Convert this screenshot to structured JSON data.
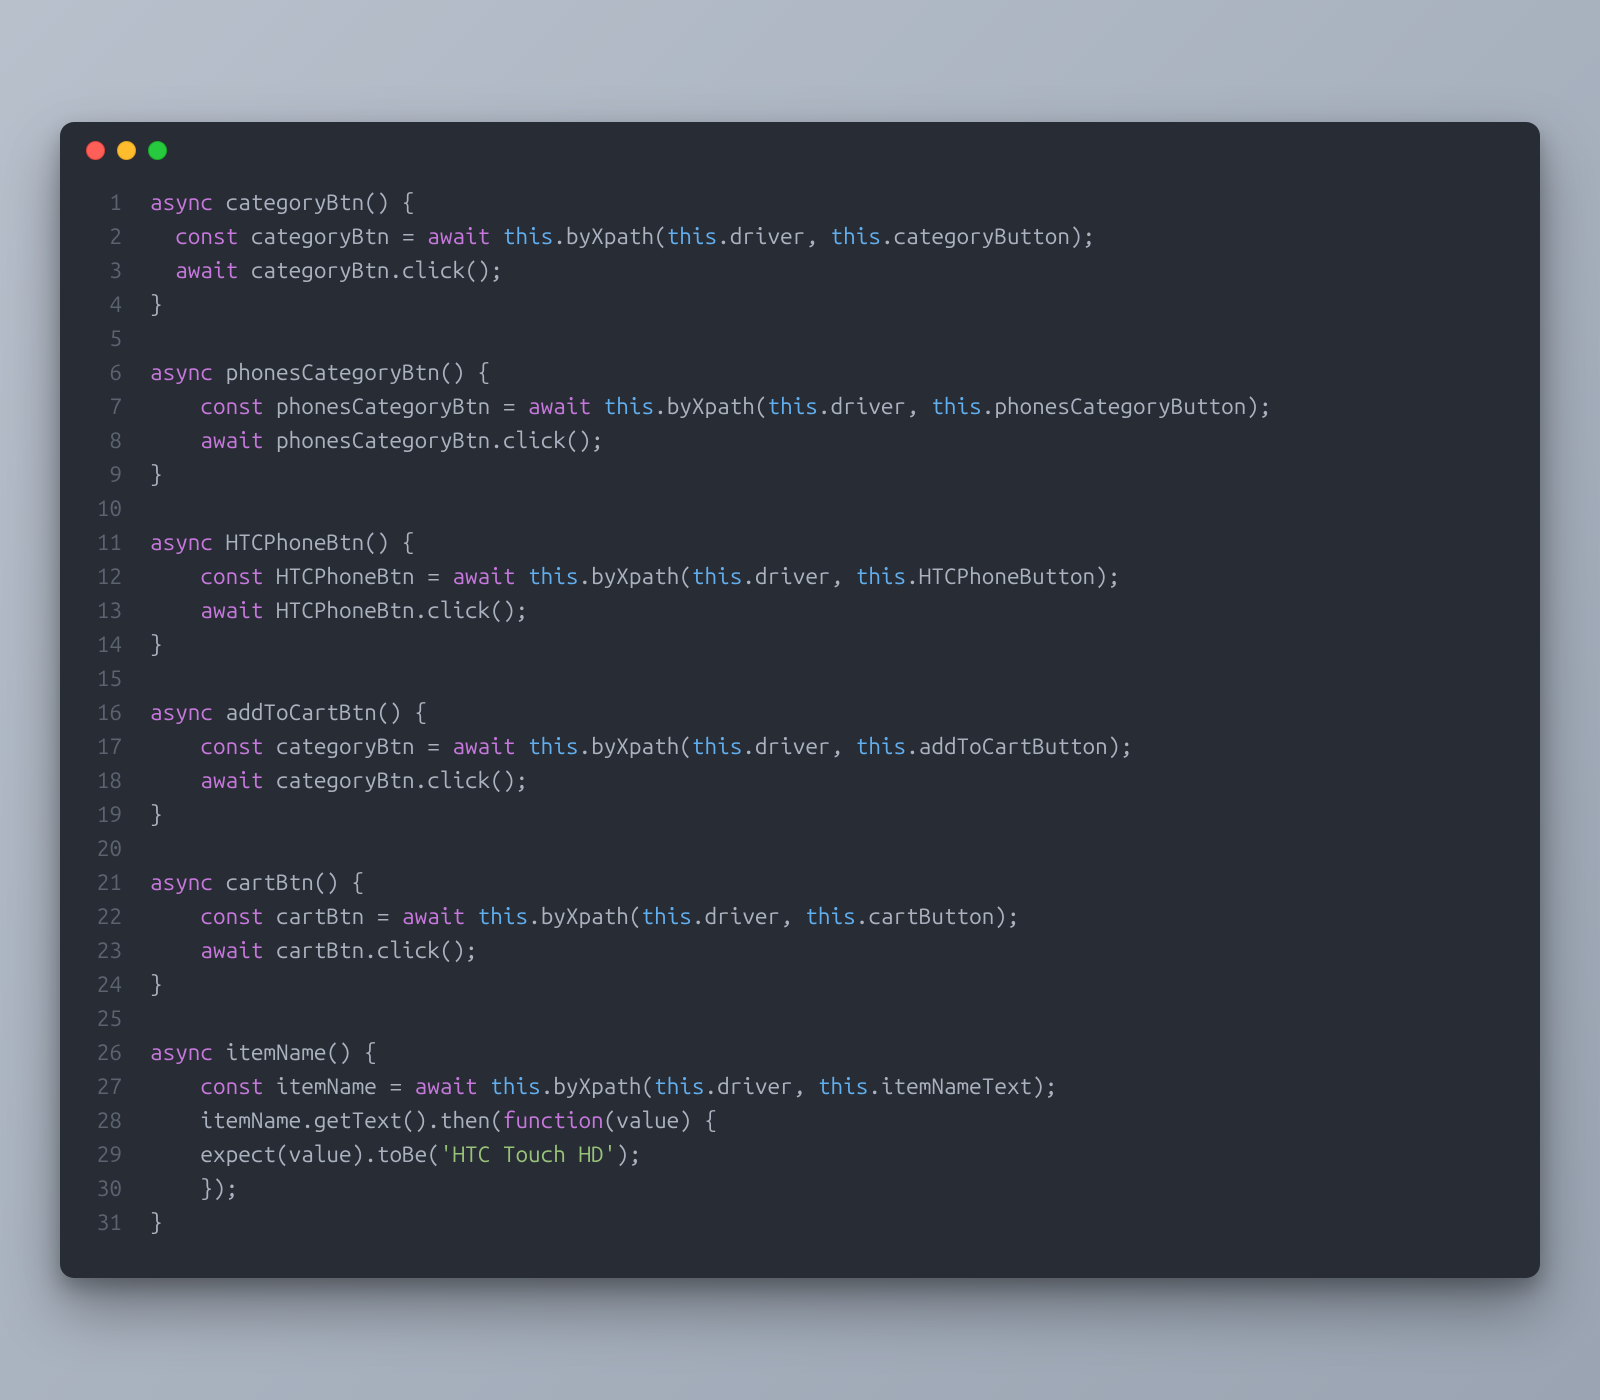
{
  "window": {
    "traffic_lights": [
      "close",
      "minimize",
      "zoom"
    ]
  },
  "code": {
    "lines": [
      {
        "n": 1,
        "tokens": [
          [
            "kw",
            "async"
          ],
          [
            "punc",
            " "
          ],
          [
            "name",
            "categoryBtn"
          ],
          [
            "punc",
            "() {"
          ]
        ]
      },
      {
        "n": 2,
        "tokens": [
          [
            "punc",
            "  "
          ],
          [
            "kw",
            "const"
          ],
          [
            "punc",
            " "
          ],
          [
            "name",
            "categoryBtn"
          ],
          [
            "punc",
            " = "
          ],
          [
            "kw",
            "await"
          ],
          [
            "punc",
            " "
          ],
          [
            "this",
            "this"
          ],
          [
            "punc",
            "."
          ],
          [
            "name",
            "byXpath"
          ],
          [
            "punc",
            "("
          ],
          [
            "this",
            "this"
          ],
          [
            "punc",
            "."
          ],
          [
            "name",
            "driver"
          ],
          [
            "punc",
            ", "
          ],
          [
            "this",
            "this"
          ],
          [
            "punc",
            "."
          ],
          [
            "name",
            "categoryButton"
          ],
          [
            "punc",
            ");"
          ]
        ]
      },
      {
        "n": 3,
        "tokens": [
          [
            "punc",
            "  "
          ],
          [
            "kw",
            "await"
          ],
          [
            "punc",
            " "
          ],
          [
            "name",
            "categoryBtn"
          ],
          [
            "punc",
            "."
          ],
          [
            "name",
            "click"
          ],
          [
            "punc",
            "();"
          ]
        ]
      },
      {
        "n": 4,
        "tokens": [
          [
            "punc",
            "}"
          ]
        ]
      },
      {
        "n": 5,
        "tokens": [
          [
            "punc",
            ""
          ]
        ]
      },
      {
        "n": 6,
        "tokens": [
          [
            "kw",
            "async"
          ],
          [
            "punc",
            " "
          ],
          [
            "name",
            "phonesCategoryBtn"
          ],
          [
            "punc",
            "() {"
          ]
        ]
      },
      {
        "n": 7,
        "tokens": [
          [
            "punc",
            "    "
          ],
          [
            "kw",
            "const"
          ],
          [
            "punc",
            " "
          ],
          [
            "name",
            "phonesCategoryBtn"
          ],
          [
            "punc",
            " = "
          ],
          [
            "kw",
            "await"
          ],
          [
            "punc",
            " "
          ],
          [
            "this",
            "this"
          ],
          [
            "punc",
            "."
          ],
          [
            "name",
            "byXpath"
          ],
          [
            "punc",
            "("
          ],
          [
            "this",
            "this"
          ],
          [
            "punc",
            "."
          ],
          [
            "name",
            "driver"
          ],
          [
            "punc",
            ", "
          ],
          [
            "this",
            "this"
          ],
          [
            "punc",
            "."
          ],
          [
            "name",
            "phonesCategoryButton"
          ],
          [
            "punc",
            ");"
          ]
        ]
      },
      {
        "n": 8,
        "tokens": [
          [
            "punc",
            "    "
          ],
          [
            "kw",
            "await"
          ],
          [
            "punc",
            " "
          ],
          [
            "name",
            "phonesCategoryBtn"
          ],
          [
            "punc",
            "."
          ],
          [
            "name",
            "click"
          ],
          [
            "punc",
            "();"
          ]
        ]
      },
      {
        "n": 9,
        "tokens": [
          [
            "punc",
            "}"
          ]
        ]
      },
      {
        "n": 10,
        "tokens": [
          [
            "punc",
            ""
          ]
        ]
      },
      {
        "n": 11,
        "tokens": [
          [
            "kw",
            "async"
          ],
          [
            "punc",
            " "
          ],
          [
            "name",
            "HTCPhoneBtn"
          ],
          [
            "punc",
            "() {"
          ]
        ]
      },
      {
        "n": 12,
        "tokens": [
          [
            "punc",
            "    "
          ],
          [
            "kw",
            "const"
          ],
          [
            "punc",
            " "
          ],
          [
            "name",
            "HTCPhoneBtn"
          ],
          [
            "punc",
            " = "
          ],
          [
            "kw",
            "await"
          ],
          [
            "punc",
            " "
          ],
          [
            "this",
            "this"
          ],
          [
            "punc",
            "."
          ],
          [
            "name",
            "byXpath"
          ],
          [
            "punc",
            "("
          ],
          [
            "this",
            "this"
          ],
          [
            "punc",
            "."
          ],
          [
            "name",
            "driver"
          ],
          [
            "punc",
            ", "
          ],
          [
            "this",
            "this"
          ],
          [
            "punc",
            "."
          ],
          [
            "name",
            "HTCPhoneButton"
          ],
          [
            "punc",
            ");"
          ]
        ]
      },
      {
        "n": 13,
        "tokens": [
          [
            "punc",
            "    "
          ],
          [
            "kw",
            "await"
          ],
          [
            "punc",
            " "
          ],
          [
            "name",
            "HTCPhoneBtn"
          ],
          [
            "punc",
            "."
          ],
          [
            "name",
            "click"
          ],
          [
            "punc",
            "();"
          ]
        ]
      },
      {
        "n": 14,
        "tokens": [
          [
            "punc",
            "}"
          ]
        ]
      },
      {
        "n": 15,
        "tokens": [
          [
            "punc",
            ""
          ]
        ]
      },
      {
        "n": 16,
        "tokens": [
          [
            "kw",
            "async"
          ],
          [
            "punc",
            " "
          ],
          [
            "name",
            "addToCartBtn"
          ],
          [
            "punc",
            "() {"
          ]
        ]
      },
      {
        "n": 17,
        "tokens": [
          [
            "punc",
            "    "
          ],
          [
            "kw",
            "const"
          ],
          [
            "punc",
            " "
          ],
          [
            "name",
            "categoryBtn"
          ],
          [
            "punc",
            " = "
          ],
          [
            "kw",
            "await"
          ],
          [
            "punc",
            " "
          ],
          [
            "this",
            "this"
          ],
          [
            "punc",
            "."
          ],
          [
            "name",
            "byXpath"
          ],
          [
            "punc",
            "("
          ],
          [
            "this",
            "this"
          ],
          [
            "punc",
            "."
          ],
          [
            "name",
            "driver"
          ],
          [
            "punc",
            ", "
          ],
          [
            "this",
            "this"
          ],
          [
            "punc",
            "."
          ],
          [
            "name",
            "addToCartButton"
          ],
          [
            "punc",
            ");"
          ]
        ]
      },
      {
        "n": 18,
        "tokens": [
          [
            "punc",
            "    "
          ],
          [
            "kw",
            "await"
          ],
          [
            "punc",
            " "
          ],
          [
            "name",
            "categoryBtn"
          ],
          [
            "punc",
            "."
          ],
          [
            "name",
            "click"
          ],
          [
            "punc",
            "();"
          ]
        ]
      },
      {
        "n": 19,
        "tokens": [
          [
            "punc",
            "}"
          ]
        ]
      },
      {
        "n": 20,
        "tokens": [
          [
            "punc",
            ""
          ]
        ]
      },
      {
        "n": 21,
        "tokens": [
          [
            "kw",
            "async"
          ],
          [
            "punc",
            " "
          ],
          [
            "name",
            "cartBtn"
          ],
          [
            "punc",
            "() {"
          ]
        ]
      },
      {
        "n": 22,
        "tokens": [
          [
            "punc",
            "    "
          ],
          [
            "kw",
            "const"
          ],
          [
            "punc",
            " "
          ],
          [
            "name",
            "cartBtn"
          ],
          [
            "punc",
            " = "
          ],
          [
            "kw",
            "await"
          ],
          [
            "punc",
            " "
          ],
          [
            "this",
            "this"
          ],
          [
            "punc",
            "."
          ],
          [
            "name",
            "byXpath"
          ],
          [
            "punc",
            "("
          ],
          [
            "this",
            "this"
          ],
          [
            "punc",
            "."
          ],
          [
            "name",
            "driver"
          ],
          [
            "punc",
            ", "
          ],
          [
            "this",
            "this"
          ],
          [
            "punc",
            "."
          ],
          [
            "name",
            "cartButton"
          ],
          [
            "punc",
            ");"
          ]
        ]
      },
      {
        "n": 23,
        "tokens": [
          [
            "punc",
            "    "
          ],
          [
            "kw",
            "await"
          ],
          [
            "punc",
            " "
          ],
          [
            "name",
            "cartBtn"
          ],
          [
            "punc",
            "."
          ],
          [
            "name",
            "click"
          ],
          [
            "punc",
            "();"
          ]
        ]
      },
      {
        "n": 24,
        "tokens": [
          [
            "punc",
            "}"
          ]
        ]
      },
      {
        "n": 25,
        "tokens": [
          [
            "punc",
            ""
          ]
        ]
      },
      {
        "n": 26,
        "tokens": [
          [
            "kw",
            "async"
          ],
          [
            "punc",
            " "
          ],
          [
            "name",
            "itemName"
          ],
          [
            "punc",
            "() {"
          ]
        ]
      },
      {
        "n": 27,
        "tokens": [
          [
            "punc",
            "    "
          ],
          [
            "kw",
            "const"
          ],
          [
            "punc",
            " "
          ],
          [
            "name",
            "itemName"
          ],
          [
            "punc",
            " = "
          ],
          [
            "kw",
            "await"
          ],
          [
            "punc",
            " "
          ],
          [
            "this",
            "this"
          ],
          [
            "punc",
            "."
          ],
          [
            "name",
            "byXpath"
          ],
          [
            "punc",
            "("
          ],
          [
            "this",
            "this"
          ],
          [
            "punc",
            "."
          ],
          [
            "name",
            "driver"
          ],
          [
            "punc",
            ", "
          ],
          [
            "this",
            "this"
          ],
          [
            "punc",
            "."
          ],
          [
            "name",
            "itemNameText"
          ],
          [
            "punc",
            ");"
          ]
        ]
      },
      {
        "n": 28,
        "tokens": [
          [
            "punc",
            "    "
          ],
          [
            "name",
            "itemName"
          ],
          [
            "punc",
            "."
          ],
          [
            "name",
            "getText"
          ],
          [
            "punc",
            "()."
          ],
          [
            "name",
            "then"
          ],
          [
            "punc",
            "("
          ],
          [
            "kw",
            "function"
          ],
          [
            "punc",
            "("
          ],
          [
            "name",
            "value"
          ],
          [
            "punc",
            ") {"
          ]
        ]
      },
      {
        "n": 29,
        "tokens": [
          [
            "punc",
            "    "
          ],
          [
            "name",
            "expect"
          ],
          [
            "punc",
            "("
          ],
          [
            "name",
            "value"
          ],
          [
            "punc",
            ")."
          ],
          [
            "name",
            "toBe"
          ],
          [
            "punc",
            "("
          ],
          [
            "str",
            "'HTC Touch HD'"
          ],
          [
            "punc",
            ");"
          ]
        ]
      },
      {
        "n": 30,
        "tokens": [
          [
            "punc",
            "    });"
          ]
        ]
      },
      {
        "n": 31,
        "tokens": [
          [
            "punc",
            "}"
          ]
        ]
      }
    ]
  }
}
